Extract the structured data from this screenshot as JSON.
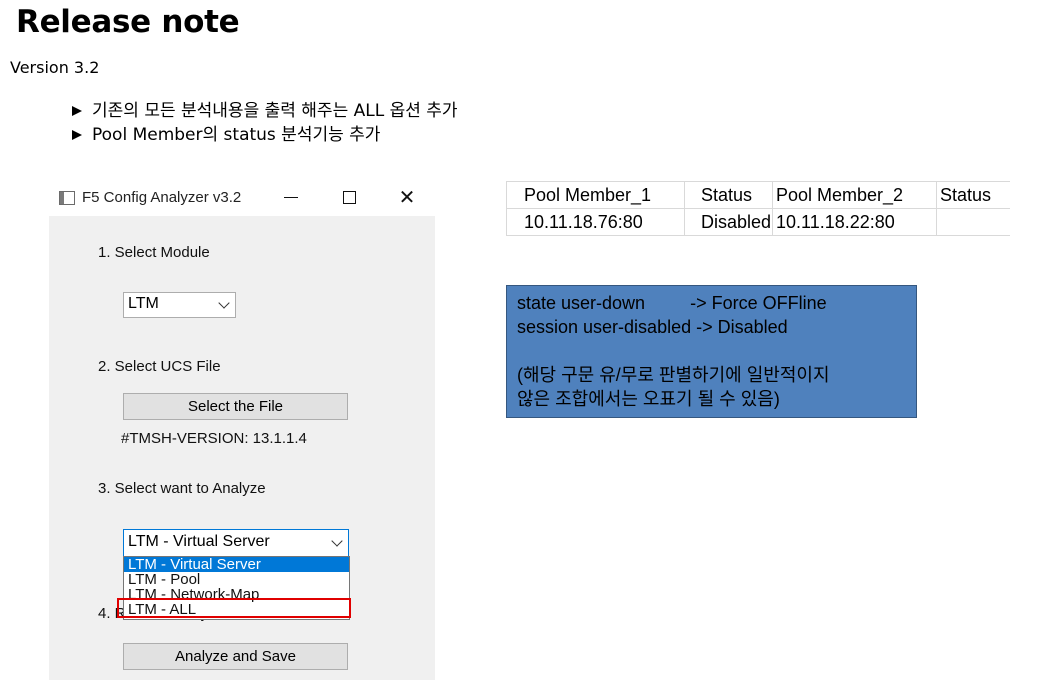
{
  "doc": {
    "title": "Release note",
    "version": "Version  3.2",
    "bullets": [
      "기존의 모든 분석내용을 출력 해주는 ALL 옵션 추가",
      "Pool Member의 status 분석기능 추가"
    ]
  },
  "app": {
    "window_title": "F5 Config Analyzer v3.2",
    "step1_label": "1. Select Module",
    "module_value": "LTM",
    "step2_label": "2. Select UCS File",
    "select_file_button": "Select the File",
    "tmsh_version": "#TMSH-VERSION: 13.1.1.4",
    "step3_label": "3. Select want to Analyze",
    "analyze_value": "LTM - Virtual Server",
    "options": [
      "LTM - Virtual Server",
      "LTM - Pool",
      "LTM - Network-Map",
      "LTM - ALL"
    ],
    "step4_label": "4. Run the Analyzer",
    "analyze_button": "Analyze and Save"
  },
  "table": {
    "headers": [
      "Pool Member_1",
      "Status",
      "Pool Member_2",
      "Status"
    ],
    "row": [
      "10.11.18.76:80",
      "Disabled",
      "10.11.18.22:80",
      ""
    ]
  },
  "note": {
    "line1": "state user-down         -> Force OFFline",
    "line2": "session user-disabled -> Disabled",
    "line3": "(해당 구문 유/무로 판별하기에 일반적이지",
    "line4": "않은 조합에서는 오표기 될 수 있음)"
  },
  "colors": {
    "note_bg": "#4f81bd",
    "highlight": "#e00000",
    "selection": "#0078d7"
  }
}
